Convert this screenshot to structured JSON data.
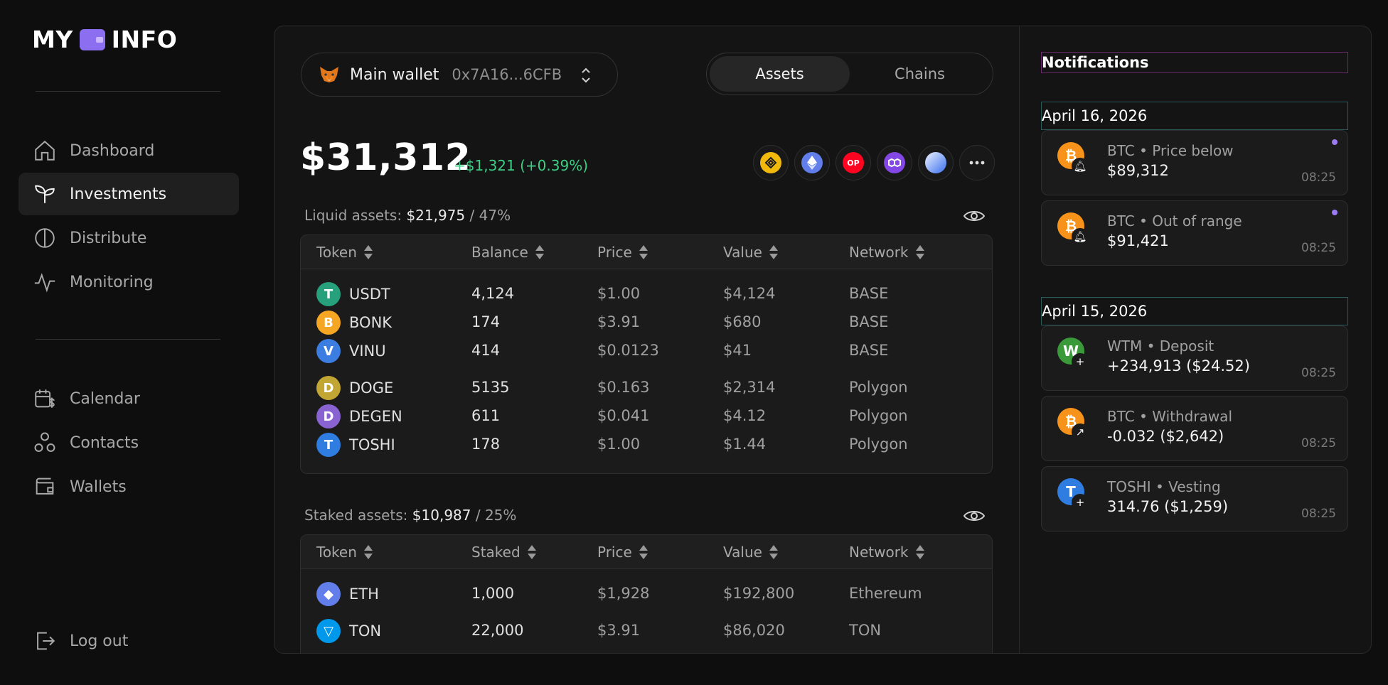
{
  "app": {
    "logo_left": "MY",
    "logo_right": "INFO"
  },
  "sidebar": {
    "items": [
      {
        "label": "Dashboard",
        "icon": "home-icon"
      },
      {
        "label": "Investments",
        "icon": "sprout-icon",
        "active": true
      },
      {
        "label": "Distribute",
        "icon": "half-circle-icon"
      },
      {
        "label": "Monitoring",
        "icon": "activity-icon"
      },
      {
        "label": "Calendar",
        "icon": "calendar-dollar-icon"
      },
      {
        "label": "Contacts",
        "icon": "contacts-icon"
      },
      {
        "label": "Wallets",
        "icon": "wallet-icon"
      }
    ],
    "logout": "Log out"
  },
  "wallet": {
    "name": "Main wallet",
    "address": "0x7A16...6CFB"
  },
  "tabs": {
    "assets": "Assets",
    "chains": "Chains",
    "active": "Assets"
  },
  "portfolio": {
    "total": "$31,312",
    "change": "+$1,321 (+0.39%)"
  },
  "chains": [
    {
      "name": "bnb-chain-icon",
      "color": "#f0b90b"
    },
    {
      "name": "ethereum-icon",
      "color": "#627eea"
    },
    {
      "name": "optimism-icon",
      "color": "#ff0420",
      "text": "OP"
    },
    {
      "name": "polygon-icon",
      "color": "#8247e5"
    },
    {
      "name": "base-icon",
      "color": "#3a6ff0"
    },
    {
      "name": "more-icon"
    }
  ],
  "liquid": {
    "label": "Liquid assets:",
    "value": "$21,975",
    "share": "/ 47%",
    "headers": [
      "Token",
      "Balance",
      "Price",
      "Value",
      "Network"
    ],
    "rows": [
      {
        "token": "USDT",
        "balance": "4,124",
        "price": "$1.00",
        "value": "$4,124",
        "network": "BASE",
        "color": "#26a17b",
        "glyph": "T"
      },
      {
        "token": "BONK",
        "balance": "174",
        "price": "$3.91",
        "value": "$680",
        "network": "BASE",
        "color": "#f5a623",
        "glyph": "B"
      },
      {
        "token": "VINU",
        "balance": "414",
        "price": "$0.0123",
        "value": "$41",
        "network": "BASE",
        "color": "#3b7de0",
        "glyph": "V"
      },
      {
        "token": "DOGE",
        "balance": "5135",
        "price": "$0.163",
        "value": "$2,314",
        "network": "Polygon",
        "color": "#c2a633",
        "glyph": "D"
      },
      {
        "token": "DEGEN",
        "balance": "611",
        "price": "$0.041",
        "value": "$4.12",
        "network": "Polygon",
        "color": "#8a63d2",
        "glyph": "D"
      },
      {
        "token": "TOSHI",
        "balance": "178",
        "price": "$1.00",
        "value": "$1.44",
        "network": "Polygon",
        "color": "#2f7de1",
        "glyph": "T"
      }
    ]
  },
  "staked": {
    "label": "Staked assets:",
    "value": "$10,987",
    "share": "/ 25%",
    "headers": [
      "Token",
      "Staked",
      "Price",
      "Value",
      "Network"
    ],
    "rows": [
      {
        "token": "ETH",
        "balance": "1,000",
        "price": "$1,928",
        "value": "$192,800",
        "network": "Ethereum",
        "color": "#627eea",
        "glyph": "◆"
      },
      {
        "token": "TON",
        "balance": "22,000",
        "price": "$3.91",
        "value": "$86,020",
        "network": "TON",
        "color": "#0098ea",
        "glyph": "▽"
      }
    ]
  },
  "notifications": {
    "title": "Notifications",
    "groups": [
      {
        "date": "April 16, 2026",
        "items": [
          {
            "title": "BTC • Price below",
            "detail": "$89,312",
            "time": "08:25",
            "unread": true,
            "color": "#f7931a",
            "glyph": "₿",
            "badge": "bell"
          },
          {
            "title": "BTC • Out of range",
            "detail": "$91,421",
            "time": "08:25",
            "unread": true,
            "color": "#f7931a",
            "glyph": "₿",
            "badge": "bell"
          }
        ]
      },
      {
        "date": "April 15, 2026",
        "items": [
          {
            "title": "WTM • Deposit",
            "detail": "+234,913 ($24.52)",
            "time": "08:25",
            "unread": false,
            "color": "#3a9a3a",
            "glyph": "W",
            "badge": "plus"
          },
          {
            "title": "BTC • Withdrawal",
            "detail": "-0.032 ($2,642)",
            "time": "08:25",
            "unread": false,
            "color": "#f7931a",
            "glyph": "₿",
            "badge": "arrow"
          },
          {
            "title": "TOSHI • Vesting",
            "detail": "314.76 ($1,259)",
            "time": "08:25",
            "unread": false,
            "color": "#2f7de1",
            "glyph": "T",
            "badge": "plus"
          }
        ]
      }
    ]
  }
}
